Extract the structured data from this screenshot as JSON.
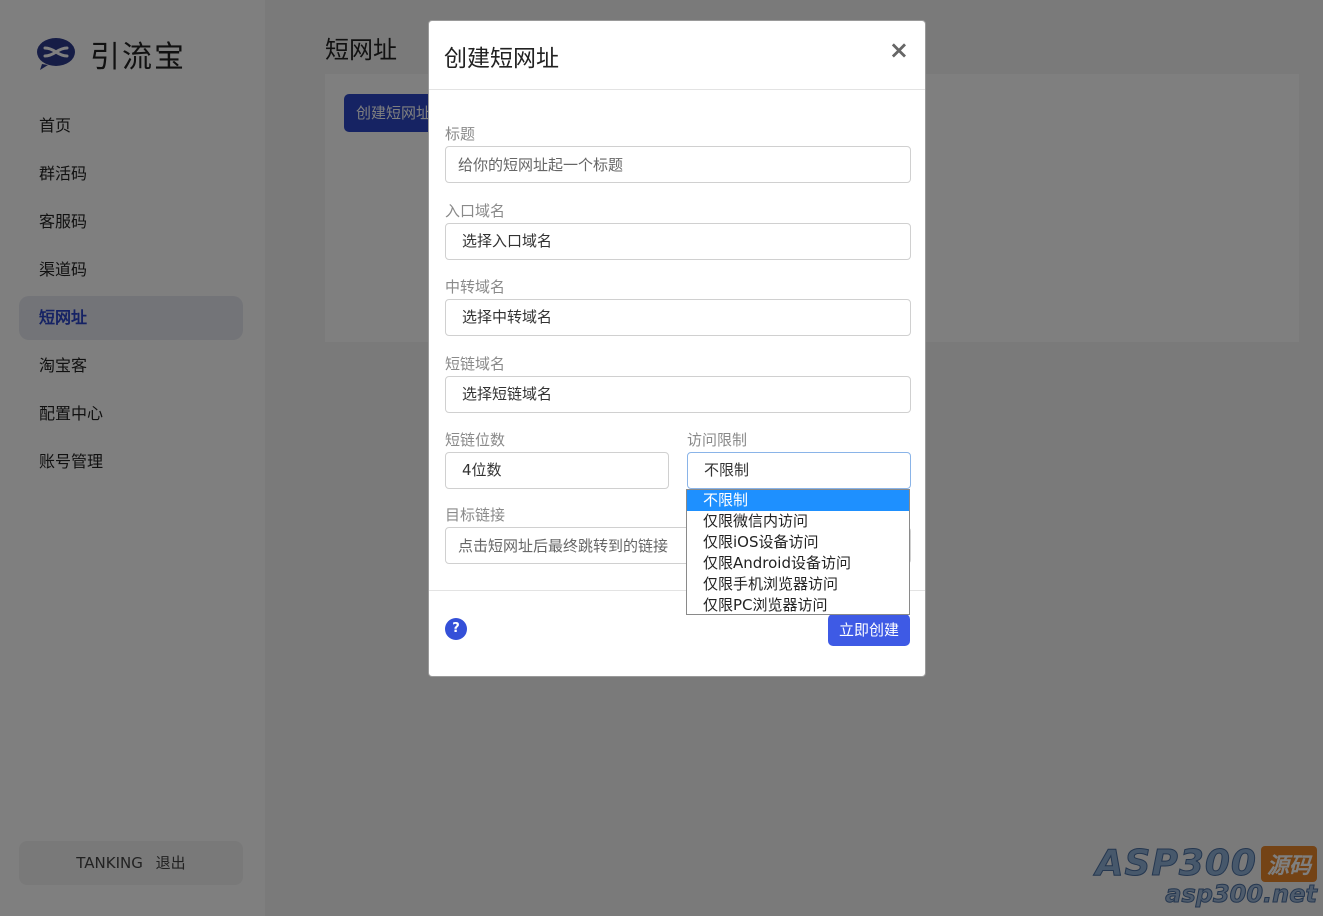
{
  "app": {
    "logo_text": "引流宝",
    "brand_color": "#2d46c6"
  },
  "sidebar": {
    "items": [
      {
        "label": "首页"
      },
      {
        "label": "群活码"
      },
      {
        "label": "客服码"
      },
      {
        "label": "渠道码"
      },
      {
        "label": "短网址",
        "active": true
      },
      {
        "label": "淘宝客"
      },
      {
        "label": "配置中心"
      },
      {
        "label": "账号管理"
      }
    ],
    "user": {
      "name": "TANKING",
      "logout_label": "退出"
    }
  },
  "main": {
    "page_title": "短网址",
    "create_button_label": "创建短网址"
  },
  "modal": {
    "title": "创建短网址",
    "close_icon": "×",
    "fields": {
      "title": {
        "label": "标题",
        "placeholder": "给你的短网址起一个标题"
      },
      "entry_domain": {
        "label": "入口域名",
        "value": "选择入口域名"
      },
      "relay_domain": {
        "label": "中转域名",
        "value": "选择中转域名"
      },
      "short_domain": {
        "label": "短链域名",
        "value": "选择短链域名"
      },
      "digits": {
        "label": "短链位数",
        "value": "4位数"
      },
      "access": {
        "label": "访问限制",
        "value": "不限制",
        "options": [
          "不限制",
          "仅限微信内访问",
          "仅限iOS设备访问",
          "仅限Android设备访问",
          "仅限手机浏览器访问",
          "仅限PC浏览器访问"
        ],
        "selected_index": 0
      },
      "target": {
        "label": "目标链接",
        "placeholder": "点击短网址后最终跳转到的链接"
      }
    },
    "help_icon": "?",
    "submit_label": "立即创建"
  },
  "watermark": {
    "brand": "ASP300",
    "tag": "源码",
    "url": "asp300.net"
  }
}
